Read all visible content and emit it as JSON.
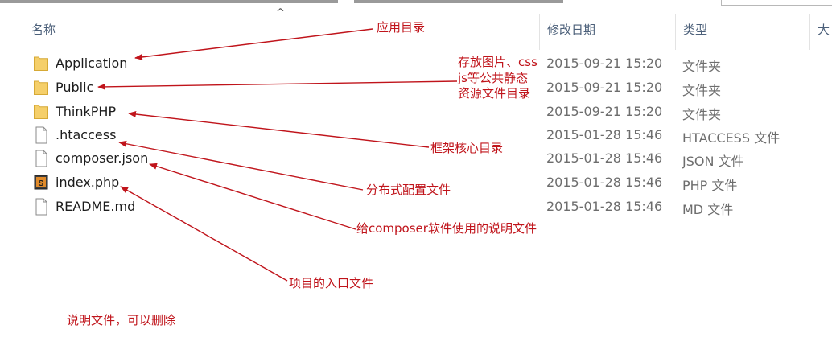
{
  "columns": {
    "name": "名称",
    "date_modified": "修改日期",
    "type": "类型",
    "size_partial": "大"
  },
  "files": [
    {
      "name": "Application",
      "date": "2015-09-21 15:20",
      "type": "文件夹",
      "icon": "folder-icon"
    },
    {
      "name": "Public",
      "date": "2015-09-21 15:20",
      "type": "文件夹",
      "icon": "folder-icon"
    },
    {
      "name": "ThinkPHP",
      "date": "2015-09-21 15:20",
      "type": "文件夹",
      "icon": "folder-icon"
    },
    {
      "name": ".htaccess",
      "date": "2015-01-28 15:46",
      "type": "HTACCESS 文件",
      "icon": "file-icon"
    },
    {
      "name": "composer.json",
      "date": "2015-01-28 15:46",
      "type": "JSON 文件",
      "icon": "file-icon"
    },
    {
      "name": "index.php",
      "date": "2015-01-28 15:46",
      "type": "PHP 文件",
      "icon": "php-file-icon"
    },
    {
      "name": "README.md",
      "date": "2015-01-28 15:46",
      "type": "MD 文件",
      "icon": "file-icon"
    }
  ],
  "annotations": {
    "app_dir": "应用目录",
    "public_line1": "存放图片、css",
    "public_line2": "js等公共静态",
    "public_line3": "资源文件目录",
    "thinkphp": "框架核心目录",
    "htaccess": "分布式配置文件",
    "composer": "给composer软件使用的说明文件",
    "index": "项目的入口文件",
    "readme": "说明文件，可以删除"
  },
  "colors": {
    "annotation": "#c0141b",
    "folder": "#f5cf6a",
    "header_text": "#4c607a"
  }
}
